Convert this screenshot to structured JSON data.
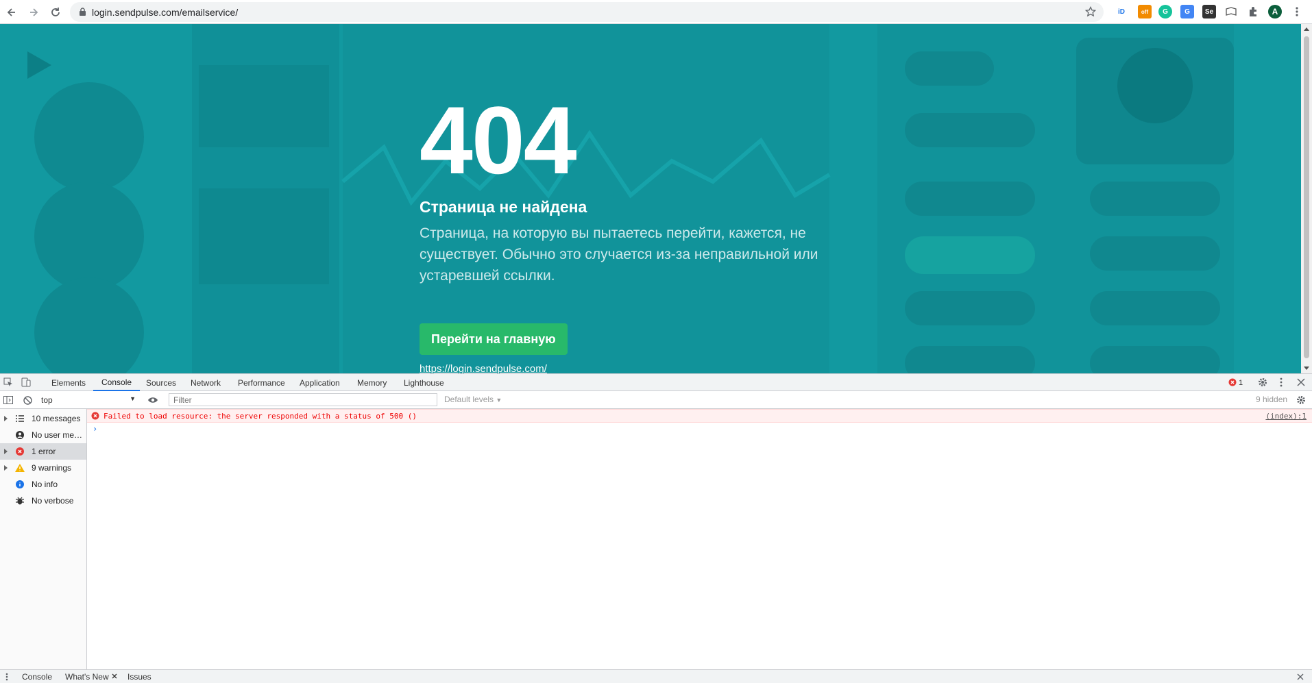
{
  "browser": {
    "url": "login.sendpulse.com/emailservice/",
    "profile_initial": "A",
    "extensions": [
      {
        "icon": "id-extension-icon",
        "text": "iD",
        "color": "#1a73e8"
      },
      {
        "icon": "off-extension-icon",
        "text": "off",
        "color": "#f28b00"
      },
      {
        "icon": "grammarly-extension-icon",
        "text": "G",
        "color": "#15c39a"
      },
      {
        "icon": "translate-extension-icon",
        "text": "G",
        "color": "#4285f4"
      },
      {
        "icon": "se-extension-icon",
        "text": "Se",
        "color": "#333333"
      },
      {
        "icon": "reader-extension-icon",
        "text": "",
        "color": "#555555"
      }
    ]
  },
  "page": {
    "error_code": "404",
    "title": "Страница не найдена",
    "description": "Страница, на которую вы пытаетесь перейти, кажется, не существует. Обычно это случается из-за неправильной или устаревшей ссылки.",
    "home_button": "Перейти на главную",
    "home_link": "https://login.sendpulse.com/",
    "bg_color": "#11969d",
    "button_color": "#28b96a"
  },
  "devtools": {
    "tabs": [
      "Elements",
      "Console",
      "Sources",
      "Network",
      "Performance",
      "Application",
      "Memory",
      "Lighthouse"
    ],
    "active_tab": "Console",
    "error_count": "1",
    "context": "top",
    "filter_placeholder": "Filter",
    "levels": "Default levels",
    "hidden": "9 hidden",
    "sidebar": [
      {
        "label": "10 messages",
        "icon": "list-icon"
      },
      {
        "label": "No user messages",
        "icon": "user-icon"
      },
      {
        "label": "1 error",
        "icon": "error-icon"
      },
      {
        "label": "9 warnings",
        "icon": "warning-icon"
      },
      {
        "label": "No info",
        "icon": "info-icon"
      },
      {
        "label": "No verbose",
        "icon": "bug-icon"
      }
    ],
    "console_messages": [
      {
        "level": "error",
        "text": "Failed to load resource: the server responded with a status of 500 ()",
        "source": "(index):1"
      }
    ],
    "prompt": "›",
    "drawer_tabs": [
      "Console",
      "What's New",
      "Issues"
    ]
  }
}
